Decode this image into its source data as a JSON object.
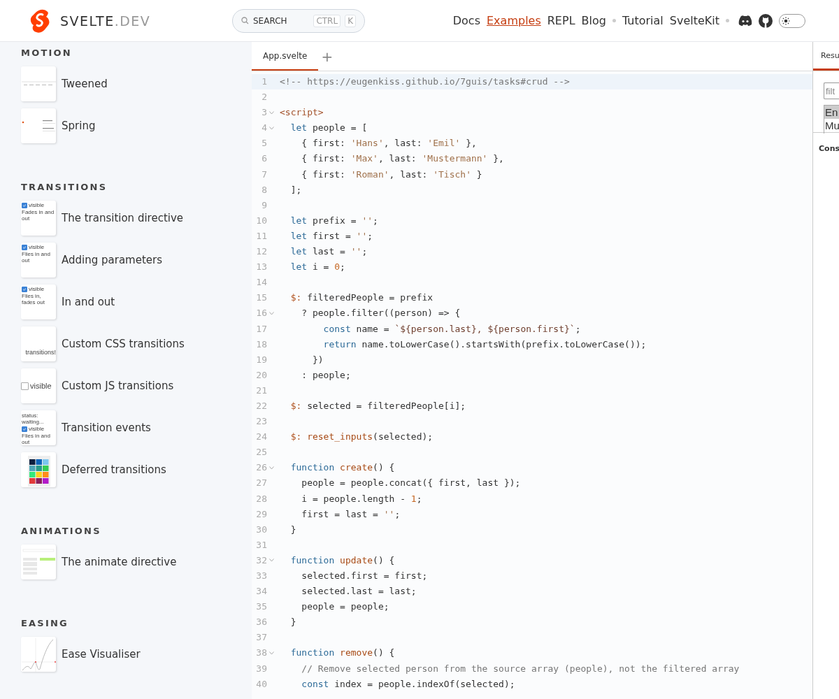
{
  "header": {
    "logo": {
      "name": "SVELTE",
      "suffix": ".DEV"
    },
    "search": {
      "label": "SEARCH",
      "keys": [
        "CTRL",
        "K"
      ]
    },
    "nav": [
      {
        "kind": "link",
        "label": "Docs",
        "selected": false
      },
      {
        "kind": "link",
        "label": "Examples",
        "selected": true
      },
      {
        "kind": "link",
        "label": "REPL",
        "selected": false
      },
      {
        "kind": "link",
        "label": "Blog",
        "selected": false
      },
      {
        "kind": "separator"
      },
      {
        "kind": "link",
        "label": "Tutorial",
        "selected": false
      },
      {
        "kind": "link",
        "label": "SvelteKit",
        "selected": false
      },
      {
        "kind": "separator"
      },
      {
        "kind": "discord"
      },
      {
        "kind": "github"
      },
      {
        "kind": "theme-toggle",
        "on": false
      }
    ]
  },
  "sidebar": {
    "sections": [
      {
        "title": "MOTION",
        "items": [
          {
            "label": "Tweened",
            "thumbnail": {
              "kind": "ticks"
            }
          },
          {
            "label": "Spring",
            "thumbnail": {
              "kind": "dot"
            }
          }
        ]
      },
      {
        "title": "TRANSITIONS",
        "items": [
          {
            "label": "The transition directive",
            "thumbnail": {
              "kind": "text",
              "checkbox": {
                "label": "visible",
                "checked": true
              },
              "lines": [
                "Fades in and out"
              ]
            }
          },
          {
            "label": "Adding parameters",
            "thumbnail": {
              "kind": "text",
              "checkbox": {
                "label": "visible",
                "checked": true
              },
              "lines": [
                "Flies in and out"
              ]
            }
          },
          {
            "label": "In and out",
            "thumbnail": {
              "kind": "text",
              "checkbox": {
                "label": "visible",
                "checked": true
              },
              "lines": [
                "Flies in, fades out"
              ]
            }
          },
          {
            "label": "Custom CSS transitions",
            "thumbnail": {
              "kind": "text",
              "lines": [
                "transitions!"
              ]
            }
          },
          {
            "label": "Custom JS transitions",
            "thumbnail": {
              "kind": "big-checkbox",
              "checkbox": {
                "label": "visible",
                "checked": false
              }
            }
          },
          {
            "label": "Transition events",
            "thumbnail": {
              "kind": "text",
              "before": "status: waiting...",
              "checkbox": {
                "label": "visible",
                "checked": true
              },
              "lines": [
                "Flies in and out"
              ]
            }
          },
          {
            "label": "Deferred transitions",
            "thumbnail": {
              "kind": "swatches"
            }
          }
        ]
      },
      {
        "title": "ANIMATIONS",
        "items": [
          {
            "label": "The animate directive",
            "thumbnail": {
              "kind": "todo"
            }
          }
        ]
      },
      {
        "title": "EASING",
        "items": [
          {
            "label": "Ease Visualiser",
            "thumbnail": {
              "kind": "curve"
            }
          }
        ]
      }
    ]
  },
  "editor": {
    "tabs": [
      {
        "label": "App.svelte",
        "selected": true
      }
    ],
    "add_tab": "+",
    "lines": [
      {
        "number": "1",
        "active": true,
        "tokens": [
          {
            "text": "<!-- https://eugenkiss.github.io/7guis/tasks#crud -->",
            "kind": "comment"
          }
        ]
      },
      {
        "number": "2",
        "active": false
      },
      {
        "number": "3",
        "active": false,
        "foldable": true,
        "tokens": [
          {
            "text": "<script>",
            "kind": "tag"
          }
        ]
      },
      {
        "number": "4",
        "active": false,
        "foldable": true,
        "tokens": [
          {
            "text": "  let ",
            "kind": "keyword"
          },
          {
            "text": "people = [",
            "kind": "plain"
          }
        ]
      },
      {
        "number": "5",
        "active": false,
        "tokens": [
          {
            "text": "    { first: ",
            "kind": "plain"
          },
          {
            "text": "'Hans'",
            "kind": "string"
          },
          {
            "text": ", last: ",
            "kind": "plain"
          },
          {
            "text": "'Emil'",
            "kind": "string"
          },
          {
            "text": " },",
            "kind": "plain"
          }
        ]
      },
      {
        "number": "6",
        "active": false,
        "tokens": [
          {
            "text": "    { first: ",
            "kind": "plain"
          },
          {
            "text": "'Max'",
            "kind": "string"
          },
          {
            "text": ", last: ",
            "kind": "plain"
          },
          {
            "text": "'Mustermann'",
            "kind": "string"
          },
          {
            "text": " },",
            "kind": "plain"
          }
        ]
      },
      {
        "number": "7",
        "active": false,
        "tokens": [
          {
            "text": "    { first: ",
            "kind": "plain"
          },
          {
            "text": "'Roman'",
            "kind": "string"
          },
          {
            "text": ", last: ",
            "kind": "plain"
          },
          {
            "text": "'Tisch'",
            "kind": "string"
          },
          {
            "text": " }",
            "kind": "plain"
          }
        ]
      },
      {
        "number": "8",
        "active": false,
        "tokens": [
          {
            "text": "  ];",
            "kind": "plain"
          }
        ]
      },
      {
        "number": "9",
        "active": false
      },
      {
        "number": "10",
        "active": false,
        "tokens": [
          {
            "text": "  let ",
            "kind": "keyword"
          },
          {
            "text": "prefix = ",
            "kind": "plain"
          },
          {
            "text": "''",
            "kind": "string"
          },
          {
            "text": ";",
            "kind": "plain"
          }
        ]
      },
      {
        "number": "11",
        "active": false,
        "tokens": [
          {
            "text": "  let ",
            "kind": "keyword"
          },
          {
            "text": "first = ",
            "kind": "plain"
          },
          {
            "text": "''",
            "kind": "string"
          },
          {
            "text": ";",
            "kind": "plain"
          }
        ]
      },
      {
        "number": "12",
        "active": false,
        "tokens": [
          {
            "text": "  let ",
            "kind": "keyword"
          },
          {
            "text": "last = ",
            "kind": "plain"
          },
          {
            "text": "''",
            "kind": "string"
          },
          {
            "text": ";",
            "kind": "plain"
          }
        ]
      },
      {
        "number": "13",
        "active": false,
        "tokens": [
          {
            "text": "  let ",
            "kind": "keyword"
          },
          {
            "text": "i = ",
            "kind": "plain"
          },
          {
            "text": "0",
            "kind": "number"
          },
          {
            "text": ";",
            "kind": "plain"
          }
        ]
      },
      {
        "number": "14",
        "active": false
      },
      {
        "number": "15",
        "active": false,
        "tokens": [
          {
            "text": "  $: ",
            "kind": "label"
          },
          {
            "text": "filteredPeople = prefix",
            "kind": "plain"
          }
        ]
      },
      {
        "number": "16",
        "active": false,
        "foldable": true,
        "tokens": [
          {
            "text": "    ? people.filter((person) => {",
            "kind": "plain"
          }
        ]
      },
      {
        "number": "17",
        "active": false,
        "tokens": [
          {
            "text": "        const ",
            "kind": "keyword"
          },
          {
            "text": "name = ",
            "kind": "plain"
          },
          {
            "text": "`${person.last}, ${person.first}`",
            "kind": "template"
          },
          {
            "text": ";",
            "kind": "plain"
          }
        ]
      },
      {
        "number": "18",
        "active": false,
        "tokens": [
          {
            "text": "        return ",
            "kind": "keyword"
          },
          {
            "text": "name.toLowerCase().startsWith(prefix.toLowerCase());",
            "kind": "plain"
          }
        ]
      },
      {
        "number": "19",
        "active": false,
        "tokens": [
          {
            "text": "      })",
            "kind": "plain"
          }
        ]
      },
      {
        "number": "20",
        "active": false,
        "tokens": [
          {
            "text": "    : people;",
            "kind": "plain"
          }
        ]
      },
      {
        "number": "21",
        "active": false
      },
      {
        "number": "22",
        "active": false,
        "tokens": [
          {
            "text": "  $: ",
            "kind": "label"
          },
          {
            "text": "selected = filteredPeople[i];",
            "kind": "plain"
          }
        ]
      },
      {
        "number": "23",
        "active": false
      },
      {
        "number": "24",
        "active": false,
        "tokens": [
          {
            "text": "  $: ",
            "kind": "label"
          },
          {
            "text": "reset_inputs",
            "kind": "function"
          },
          {
            "text": "(selected);",
            "kind": "plain"
          }
        ]
      },
      {
        "number": "25",
        "active": false
      },
      {
        "number": "26",
        "active": false,
        "foldable": true,
        "tokens": [
          {
            "text": "  function ",
            "kind": "keyword"
          },
          {
            "text": "create",
            "kind": "function"
          },
          {
            "text": "() {",
            "kind": "plain"
          }
        ]
      },
      {
        "number": "27",
        "active": false,
        "tokens": [
          {
            "text": "    people = people.concat({ first, last });",
            "kind": "plain"
          }
        ]
      },
      {
        "number": "28",
        "active": false,
        "tokens": [
          {
            "text": "    i = people.length - ",
            "kind": "plain"
          },
          {
            "text": "1",
            "kind": "number"
          },
          {
            "text": ";",
            "kind": "plain"
          }
        ]
      },
      {
        "number": "29",
        "active": false,
        "tokens": [
          {
            "text": "    first = last = ",
            "kind": "plain"
          },
          {
            "text": "''",
            "kind": "string"
          },
          {
            "text": ";",
            "kind": "plain"
          }
        ]
      },
      {
        "number": "30",
        "active": false,
        "tokens": [
          {
            "text": "  }",
            "kind": "plain"
          }
        ]
      },
      {
        "number": "31",
        "active": false
      },
      {
        "number": "32",
        "active": false,
        "foldable": true,
        "tokens": [
          {
            "text": "  function ",
            "kind": "keyword"
          },
          {
            "text": "update",
            "kind": "function"
          },
          {
            "text": "() {",
            "kind": "plain"
          }
        ]
      },
      {
        "number": "33",
        "active": false,
        "tokens": [
          {
            "text": "    selected.first = first;",
            "kind": "plain"
          }
        ]
      },
      {
        "number": "34",
        "active": false,
        "tokens": [
          {
            "text": "    selected.last = last;",
            "kind": "plain"
          }
        ]
      },
      {
        "number": "35",
        "active": false,
        "tokens": [
          {
            "text": "    people = people;",
            "kind": "plain"
          }
        ]
      },
      {
        "number": "36",
        "active": false,
        "tokens": [
          {
            "text": "  }",
            "kind": "plain"
          }
        ]
      },
      {
        "number": "37",
        "active": false
      },
      {
        "number": "38",
        "active": false,
        "foldable": true,
        "tokens": [
          {
            "text": "  function ",
            "kind": "keyword"
          },
          {
            "text": "remove",
            "kind": "function"
          },
          {
            "text": "() {",
            "kind": "plain"
          }
        ]
      },
      {
        "number": "39",
        "active": false,
        "tokens": [
          {
            "text": "    // Remove selected person from the source array (people), not the filtered array",
            "kind": "comment"
          }
        ]
      },
      {
        "number": "40",
        "active": false,
        "tokens": [
          {
            "text": "    const ",
            "kind": "keyword"
          },
          {
            "text": "index = people.indexOf(selected);",
            "kind": "plain"
          }
        ]
      }
    ]
  },
  "result": {
    "tabs": [
      {
        "label": "Resu",
        "selected": true
      }
    ],
    "filter": {
      "placeholder": "filt"
    },
    "list": [
      {
        "label": "En",
        "selected": true
      },
      {
        "label": "Mu",
        "selected": false
      }
    ],
    "console": {
      "title": "Cons"
    }
  }
}
